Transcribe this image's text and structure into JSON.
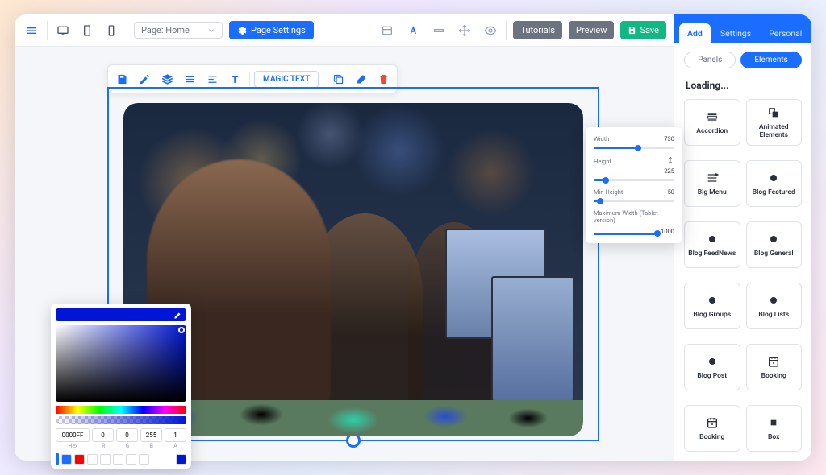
{
  "topbar": {
    "page_label": "Page: Home",
    "settings_label": "Page Settings",
    "tutorials_label": "Tutorials",
    "preview_label": "Preview",
    "save_label": "Save"
  },
  "floating_toolbar": {
    "magic_label": "MAGIC TEXT"
  },
  "size_panel": {
    "width": {
      "label": "Width",
      "value": "730",
      "pct": 55
    },
    "height": {
      "label": "Height",
      "value": "225",
      "pct": 15,
      "auto_icon": true
    },
    "min_height": {
      "label": "Min Height",
      "value": "50",
      "pct": 8
    },
    "max_width": {
      "label": "Maximum Width (Tablet version)",
      "value": "1000",
      "pct": 100
    }
  },
  "color_picker": {
    "hex": "0000FF",
    "r": "0",
    "g": "0",
    "b": "255",
    "a": "1",
    "labels": {
      "hex": "Hex",
      "r": "R",
      "g": "G",
      "b": "B",
      "a": "A"
    },
    "swatches": [
      "#1a6dff",
      "#ff0000",
      "",
      "",
      "",
      "",
      ""
    ],
    "current": "#0015d6"
  },
  "sidebar": {
    "tabs": [
      {
        "label": "Add",
        "active": true
      },
      {
        "label": "Settings",
        "active": false
      },
      {
        "label": "Personal",
        "active": false
      }
    ],
    "sub": [
      {
        "label": "Panels",
        "active": false
      },
      {
        "label": "Elements",
        "active": true
      }
    ],
    "heading": "Loading...",
    "items": [
      {
        "icon": "accordion",
        "label": "Accordion"
      },
      {
        "icon": "animated",
        "label": "Animated Elements"
      },
      {
        "icon": "bigmenu",
        "label": "Big Menu"
      },
      {
        "icon": "dot",
        "label": "Blog Featured"
      },
      {
        "icon": "dot",
        "label": "Blog FeedNews"
      },
      {
        "icon": "dot",
        "label": "Blog General"
      },
      {
        "icon": "dot",
        "label": "Blog Groups"
      },
      {
        "icon": "dot",
        "label": "Blog Lists"
      },
      {
        "icon": "dot",
        "label": "Blog Post"
      },
      {
        "icon": "calendar",
        "label": "Booking"
      },
      {
        "icon": "calendar",
        "label": "Booking"
      },
      {
        "icon": "square",
        "label": "Box"
      }
    ]
  }
}
